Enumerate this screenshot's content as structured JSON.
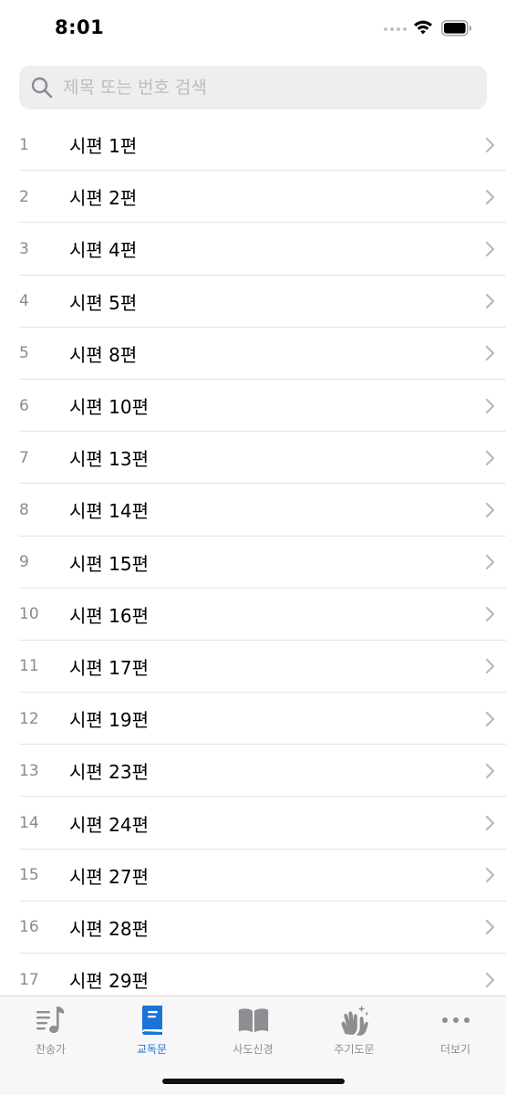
{
  "status_bar": {
    "time": "8:01"
  },
  "search": {
    "placeholder": "제목 또는 번호 검색"
  },
  "list": {
    "items": [
      {
        "number": "1",
        "title": "시편 1편"
      },
      {
        "number": "2",
        "title": "시편 2편"
      },
      {
        "number": "3",
        "title": "시편 4편"
      },
      {
        "number": "4",
        "title": "시편 5편"
      },
      {
        "number": "5",
        "title": "시편 8편"
      },
      {
        "number": "6",
        "title": "시편 10편"
      },
      {
        "number": "7",
        "title": "시편 13편"
      },
      {
        "number": "8",
        "title": "시편 14편"
      },
      {
        "number": "9",
        "title": "시편 15편"
      },
      {
        "number": "10",
        "title": "시편 16편"
      },
      {
        "number": "11",
        "title": "시편 17편"
      },
      {
        "number": "12",
        "title": "시편 19편"
      },
      {
        "number": "13",
        "title": "시편 23편"
      },
      {
        "number": "14",
        "title": "시편 24편"
      },
      {
        "number": "15",
        "title": "시편 27편"
      },
      {
        "number": "16",
        "title": "시편 28편"
      },
      {
        "number": "17",
        "title": "시편 29편"
      }
    ]
  },
  "tab_bar": {
    "active_color": "#1a73d8",
    "inactive_color": "#8e8e92",
    "tabs": [
      {
        "label": "찬송가",
        "icon": "music-note-list-icon",
        "active": false
      },
      {
        "label": "교독문",
        "icon": "book-closed-icon",
        "active": true
      },
      {
        "label": "사도신경",
        "icon": "book-open-icon",
        "active": false
      },
      {
        "label": "주기도문",
        "icon": "praying-hands-icon",
        "active": false
      },
      {
        "label": "더보기",
        "icon": "ellipsis-icon",
        "active": false
      }
    ]
  }
}
